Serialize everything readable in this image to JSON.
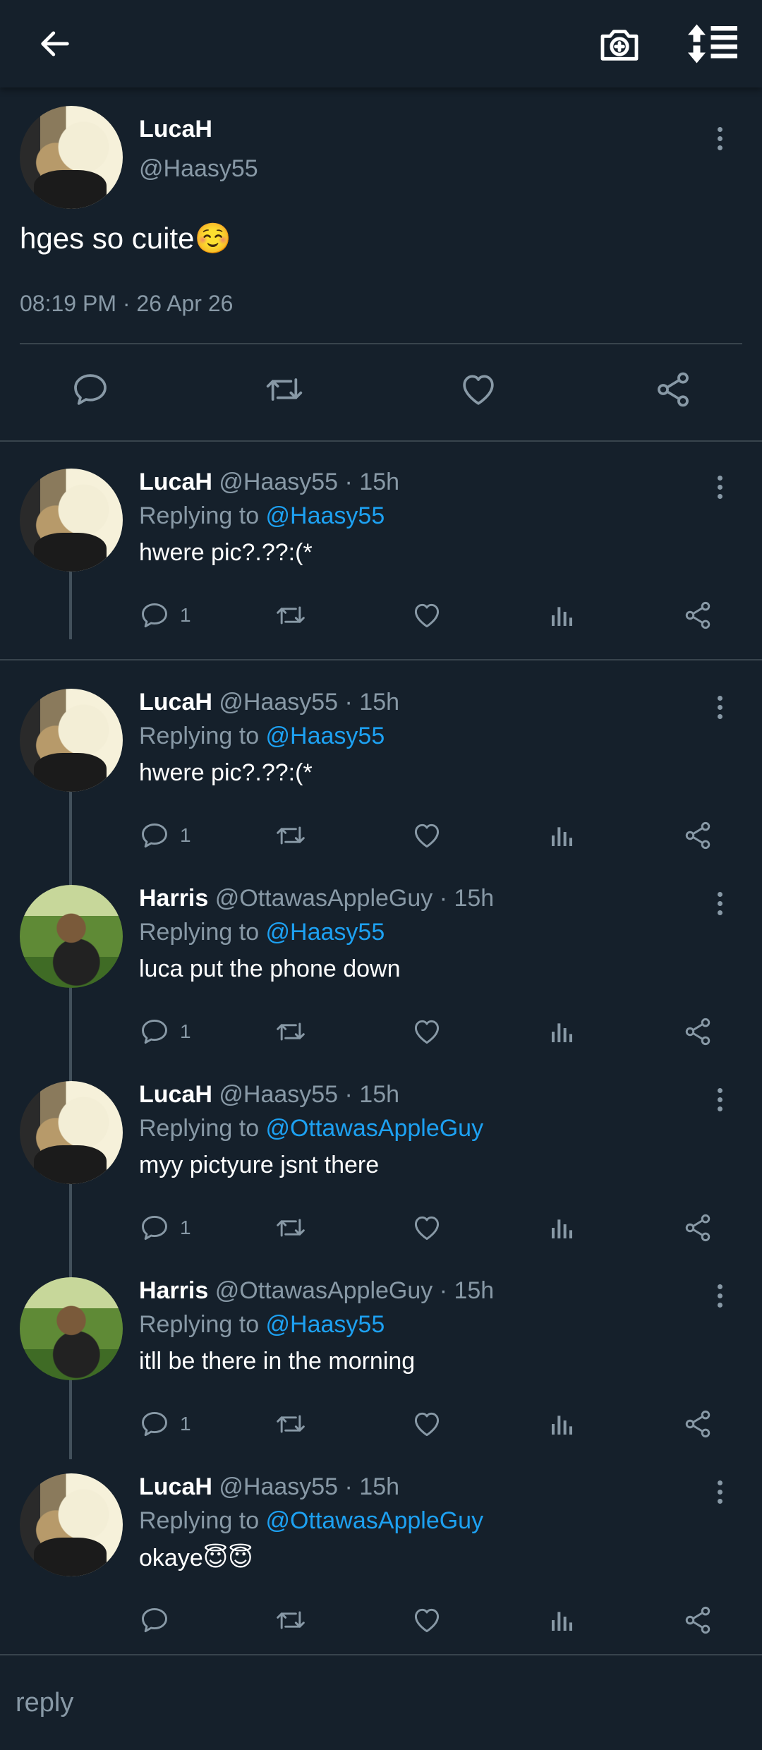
{
  "topbar": {
    "icons": [
      "arrow-left-icon",
      "camera-plus-icon",
      "sort-list-icon"
    ]
  },
  "main_post": {
    "name": "LucaH",
    "handle": "@Haasy55",
    "text": "hges so cuite☺️",
    "timestamp": "08:19 PM · 26 Apr 26"
  },
  "replies": [
    {
      "name": "LucaH",
      "meta": "@Haasy55 · 15h",
      "replying_prefix": "Replying to ",
      "mention": "@Haasy55",
      "text": "hwere pic?.??:(*",
      "reply_count": "1"
    },
    {
      "name": "LucaH",
      "meta": "@Haasy55 · 15h",
      "replying_prefix": "Replying to ",
      "mention": "@Haasy55",
      "text": "hwere pic?.??:(*",
      "reply_count": "1"
    },
    {
      "name": "Harris",
      "meta": "@OttawasAppleGuy · 15h",
      "replying_prefix": "Replying to ",
      "mention": "@Haasy55",
      "text": "luca put the phone down",
      "reply_count": "1"
    },
    {
      "name": "LucaH",
      "meta": "@Haasy55 · 15h",
      "replying_prefix": "Replying to ",
      "mention": "@OttawasAppleGuy",
      "text": "myy pictyure jsnt there",
      "reply_count": "1"
    },
    {
      "name": "Harris",
      "meta": "@OttawasAppleGuy · 15h",
      "replying_prefix": "Replying to ",
      "mention": "@Haasy55",
      "text": "itll be there in the morning",
      "reply_count": "1"
    },
    {
      "name": "LucaH",
      "meta": "@Haasy55 · 15h",
      "replying_prefix": "Replying to ",
      "mention": "@OttawasAppleGuy",
      "text": "okaye😇😇",
      "reply_count": ""
    }
  ],
  "reply_bar": {
    "placeholder": "reply"
  },
  "colors": {
    "background": "#15202b",
    "muted": "#8899a6",
    "accent": "#1da1f2",
    "divider": "#38444d"
  }
}
